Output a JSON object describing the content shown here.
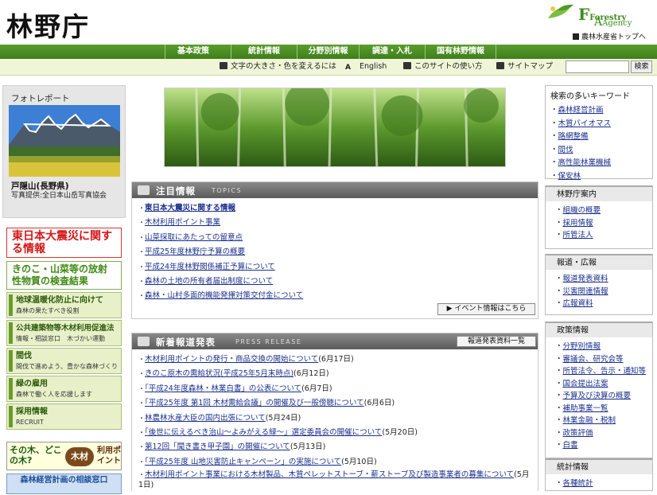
{
  "header": {
    "title": "林野庁",
    "logo_text_1": "Forestry",
    "logo_text_2": "Agency",
    "logo_big_f": "F",
    "logo_big_a": "A",
    "maff_link": "農林水産省トップへ"
  },
  "nav1": [
    "基本政策",
    "統計情報",
    "分野別情報",
    "調達・入札",
    "国有林野情報"
  ],
  "nav2": {
    "font_size": "文字の大きさ・色を変えるには",
    "english": "English",
    "howto": "このサイトの使い方",
    "sitemap": "サイトマップ",
    "search_placeholder": "",
    "search_button": "検索"
  },
  "left": {
    "photo": {
      "title": "フォトレポート",
      "place": "戸隠山(長野県)",
      "credit": "写真提供:全日本山岳写真協会"
    },
    "quake": "東日本大震災に関する情報",
    "radiation": "きのこ・山菜等の放射性物質の検査結果",
    "buttons": [
      {
        "title": "地球温暖化防止に向けて",
        "sub": "森林の果たすべき役割"
      },
      {
        "title": "公共建築物等木材利用促進法",
        "sub": "情報・相談窓口　木づかい運動"
      },
      {
        "title": "間伐",
        "sub": "間伐で進めよう、豊かな森林づくり"
      },
      {
        "title": "緑の雇用",
        "sub": "森林で働く人を応援します"
      },
      {
        "title": "採用情報",
        "sub": "RECRUIT"
      }
    ],
    "kizai": {
      "a": "その木、どこの木?",
      "b": "木材",
      "c": "利用ポイント"
    },
    "madoguchi": "森林経営計画の相談窓口"
  },
  "topics": {
    "title": "注目情報",
    "en": "TOPICS",
    "event_button": "イベント情報はこちら",
    "items": [
      "東日本大震災に関する情報",
      "木材利用ポイント事業",
      "山菜採取にあたっての留意点",
      "平成25年度林野庁予算の概要",
      "平成24年度林野関係補正予算について",
      "森林の土地の所有者届出制度について",
      "森林・山村多面的機能発揮対策交付金について"
    ]
  },
  "press": {
    "title": "新着報道発表",
    "en": "PRESS RELEASE",
    "all_button": "報道発表資料一覧",
    "items": [
      {
        "text": "木材利用ポイントの発行・商品交換の開始について",
        "date": "(6月17日)"
      },
      {
        "text": "きのこ原木の需給状況(平成25年5月末時点)",
        "date": "(6月12日)"
      },
      {
        "text": "「平成24年度森林・林業白書」の公表について",
        "date": "(6月7日)"
      },
      {
        "text": "「平成25年度 第1回 木材需給会議」の開催及び一般傍聴について",
        "date": "(6月6日)"
      },
      {
        "text": "林農林水産大臣の国内出張について",
        "date": "(5月24日)"
      },
      {
        "text": "「後世に伝えるべき治山～よみがえる緑～」選定委員会の開催について",
        "date": "(5月20日)"
      },
      {
        "text": "第12回「聞き書き甲子園」の開催について",
        "date": "(5月13日)"
      },
      {
        "text": "「平成25年度 山地災害防止キャンペーン」の実施について",
        "date": "(5月10日)"
      },
      {
        "text": "木材利用ポイント事業における木材製品、木質ペレットストーブ・薪ストーブ及び製造事業者の募集について",
        "date": "(5月1日)"
      }
    ]
  },
  "right": {
    "keywords": {
      "title": "検索の多いキーワード",
      "items": [
        "森林経営計画",
        "木質バイオマス",
        "路網整備",
        "間伐",
        "高性能林業機械",
        "保安林"
      ]
    },
    "boxes": [
      {
        "title": "林野庁案内",
        "items": [
          "組織の概要",
          "採用情報",
          "所管法人"
        ]
      },
      {
        "title": "報道・広報",
        "items": [
          "報道発表資料",
          "災害関連情報",
          "広報資料"
        ]
      },
      {
        "title": "政策情報",
        "items": [
          "分野別情報",
          "審議会、研究会等",
          "所管法令、告示・通知等",
          "国会提出法案",
          "予算及び決算の概要",
          "補助事業一覧",
          "林業金融・税制",
          "政策評価",
          "白書"
        ]
      },
      {
        "title": "統計情報",
        "items": [
          "各種統計"
        ]
      }
    ]
  },
  "colors": {
    "nav_green": "#4a8a24",
    "accent_red": "#d41616",
    "link_blue": "#1a2f8c"
  }
}
